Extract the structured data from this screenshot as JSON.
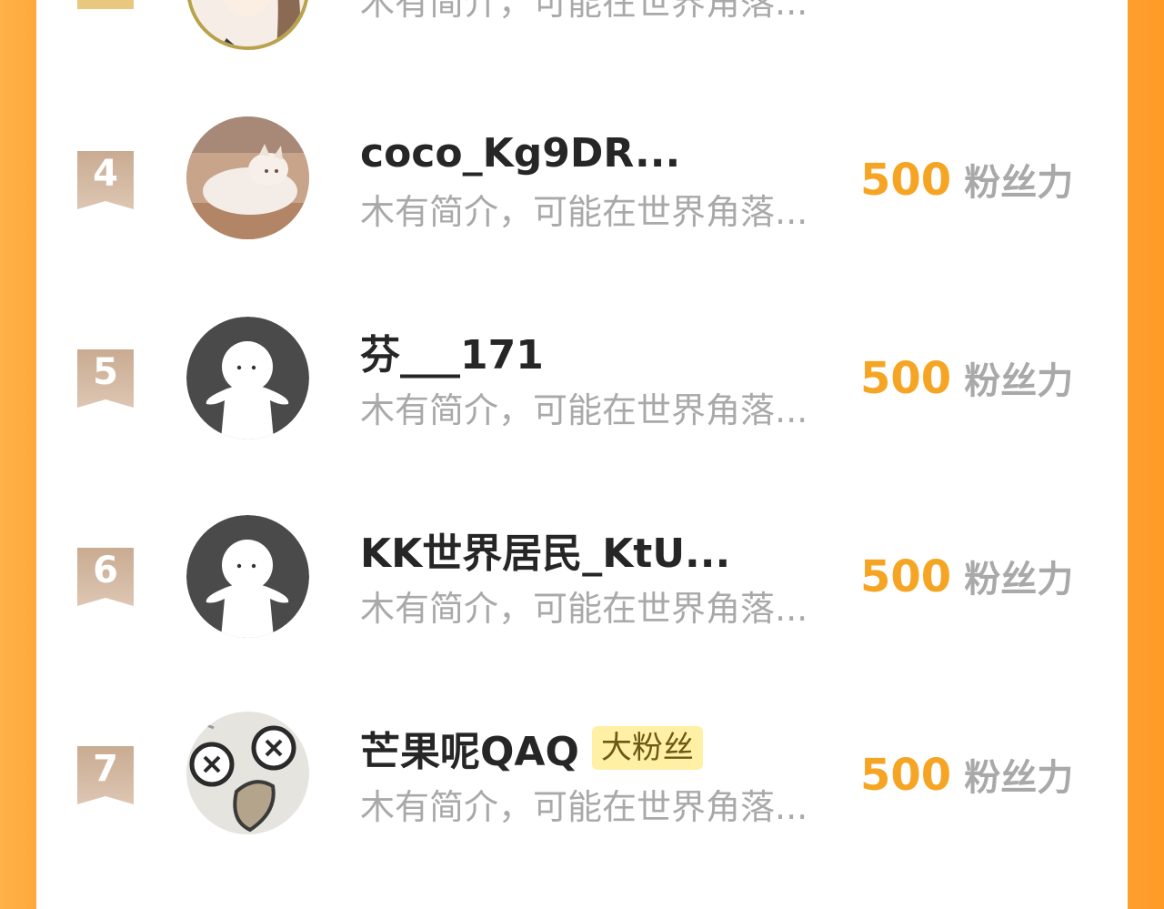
{
  "leaderboard": {
    "partial_top": {
      "bio": "木有简介，可能在世界角落..."
    },
    "entries": [
      {
        "rank": "4",
        "name": "coco_Kg9DR...",
        "bio": "木有简介，可能在世界角落...",
        "points": "500",
        "points_unit": "粉丝力",
        "avatar": "cat-photo"
      },
      {
        "rank": "5",
        "name": "芬___171",
        "bio": "木有简介，可能在世界角落...",
        "points": "500",
        "points_unit": "粉丝力",
        "avatar": "default-person-icon"
      },
      {
        "rank": "6",
        "name": "KK世界居民_KtU...",
        "bio": "木有简介，可能在世界角落...",
        "points": "500",
        "points_unit": "粉丝力",
        "avatar": "default-person-icon"
      },
      {
        "rank": "7",
        "name": "芒果呢QAQ",
        "badge": "大粉丝",
        "bio": "木有简介，可能在世界角落...",
        "points": "500",
        "points_unit": "粉丝力",
        "avatar": "cartoon-face"
      }
    ]
  },
  "colors": {
    "accent_orange": "#f5a523",
    "frame_orange": "#ffa83a",
    "badge_bg": "#fff0a6",
    "ribbon": "#c9ab91"
  }
}
